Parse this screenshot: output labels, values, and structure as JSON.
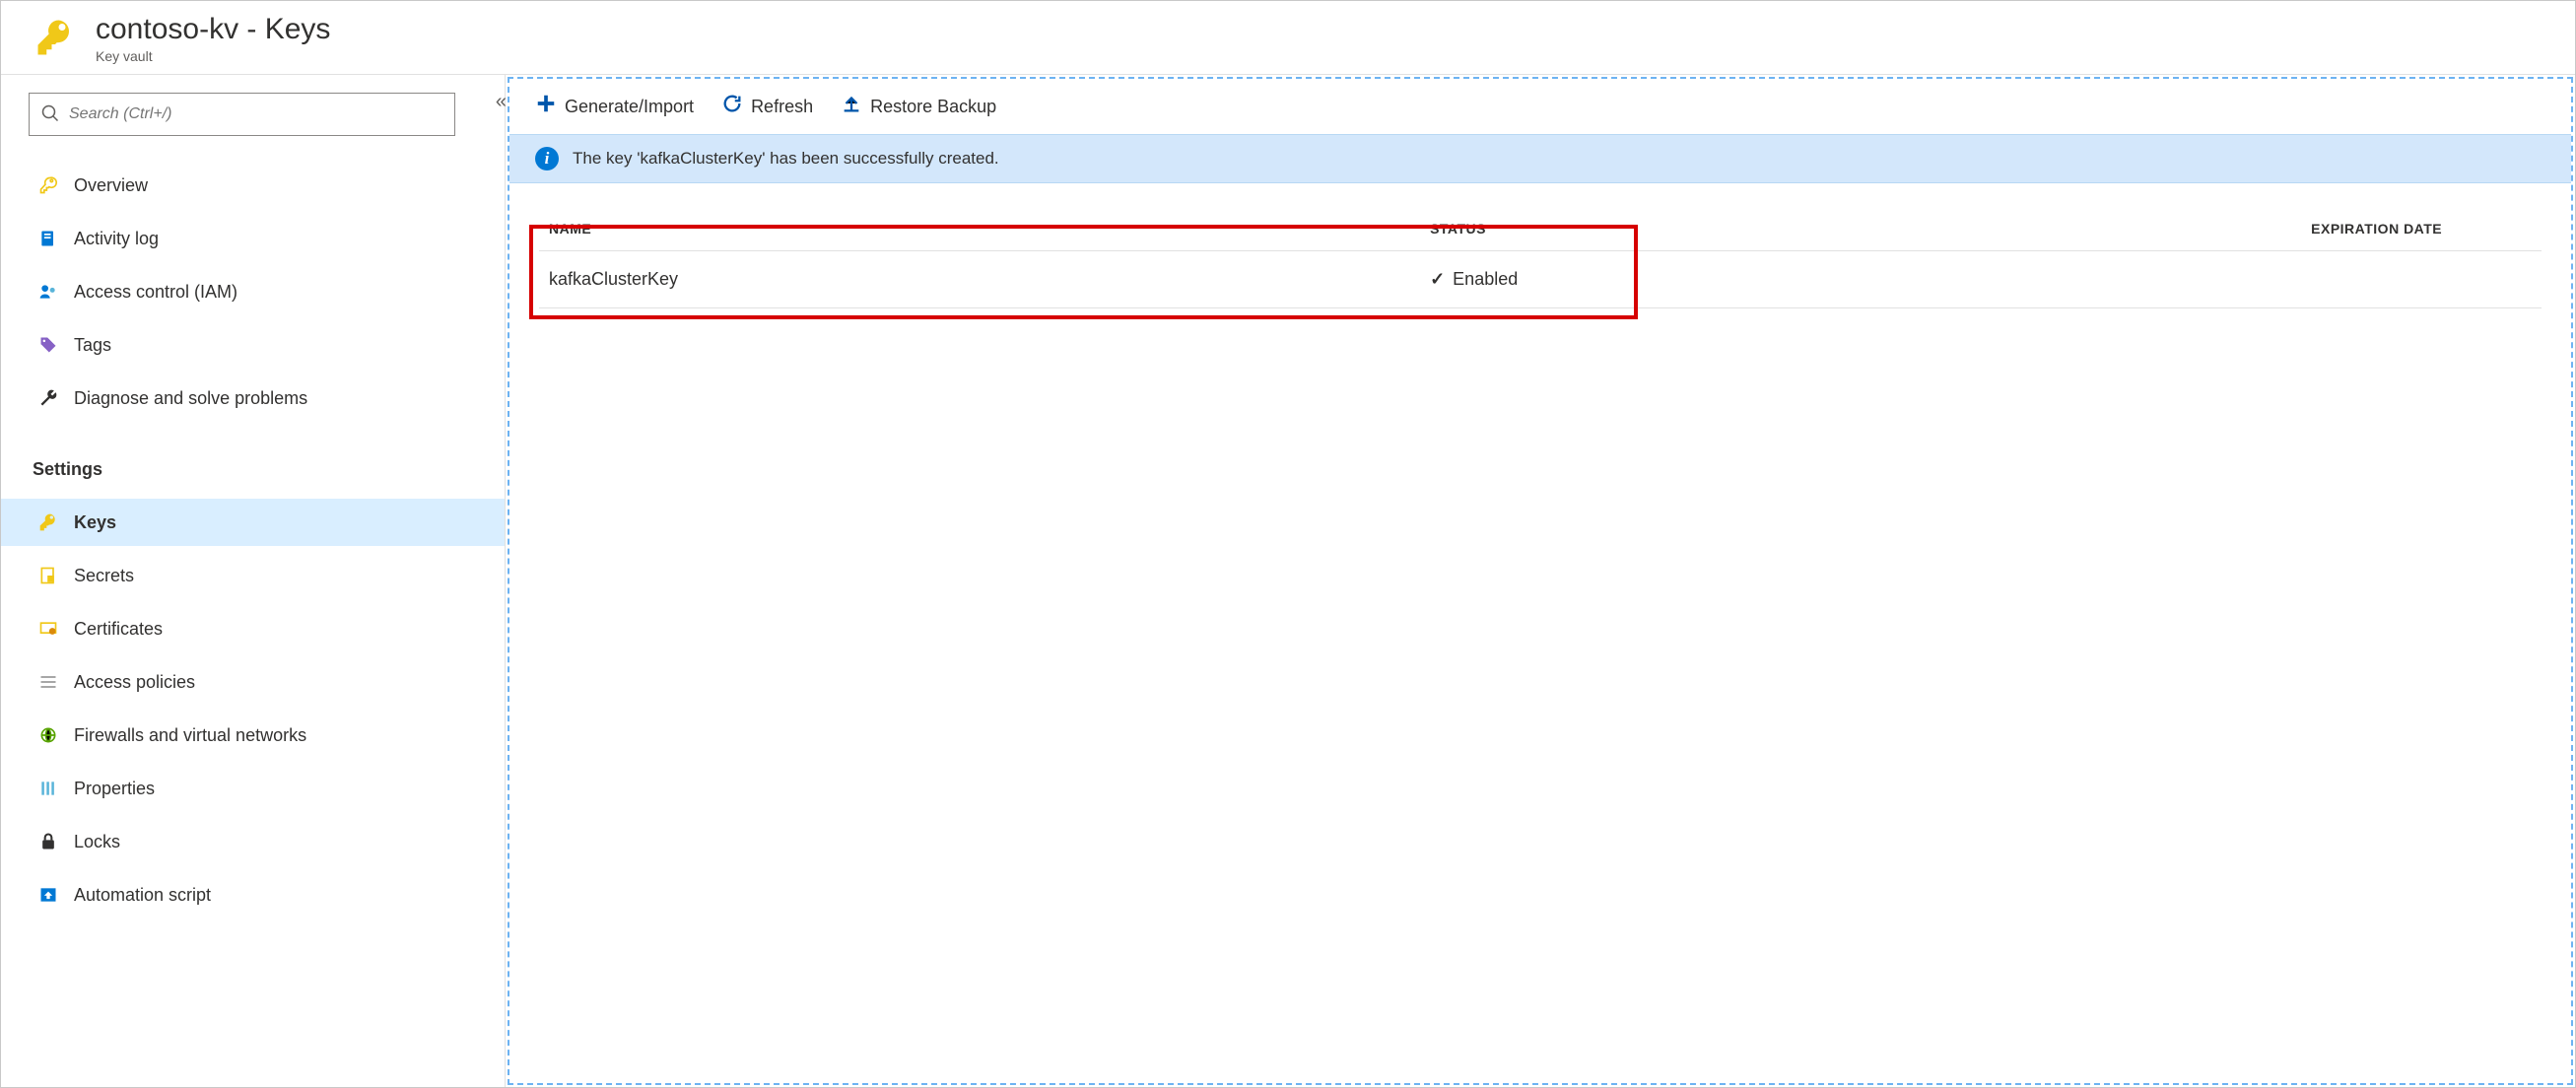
{
  "header": {
    "title": "contoso-kv - Keys",
    "subtitle": "Key vault"
  },
  "sidebar": {
    "search_placeholder": "Search (Ctrl+/)",
    "items": [
      {
        "label": "Overview",
        "icon": "key-outline"
      },
      {
        "label": "Activity log",
        "icon": "log"
      },
      {
        "label": "Access control (IAM)",
        "icon": "iam"
      },
      {
        "label": "Tags",
        "icon": "tag"
      },
      {
        "label": "Diagnose and solve problems",
        "icon": "wrench"
      }
    ],
    "settings_heading": "Settings",
    "settings_items": [
      {
        "label": "Keys",
        "icon": "key",
        "active": true
      },
      {
        "label": "Secrets",
        "icon": "secret"
      },
      {
        "label": "Certificates",
        "icon": "cert"
      },
      {
        "label": "Access policies",
        "icon": "policies"
      },
      {
        "label": "Firewalls and virtual networks",
        "icon": "firewall"
      },
      {
        "label": "Properties",
        "icon": "props"
      },
      {
        "label": "Locks",
        "icon": "lock"
      },
      {
        "label": "Automation script",
        "icon": "script"
      }
    ]
  },
  "toolbar": {
    "generate_label": "Generate/Import",
    "refresh_label": "Refresh",
    "restore_label": "Restore Backup"
  },
  "notification": {
    "text": "The key 'kafkaClusterKey' has been successfully created."
  },
  "table": {
    "headers": {
      "name": "NAME",
      "status": "STATUS",
      "expiration": "EXPIRATION DATE"
    },
    "rows": [
      {
        "name": "kafkaClusterKey",
        "status": "Enabled",
        "expiration": ""
      }
    ]
  }
}
